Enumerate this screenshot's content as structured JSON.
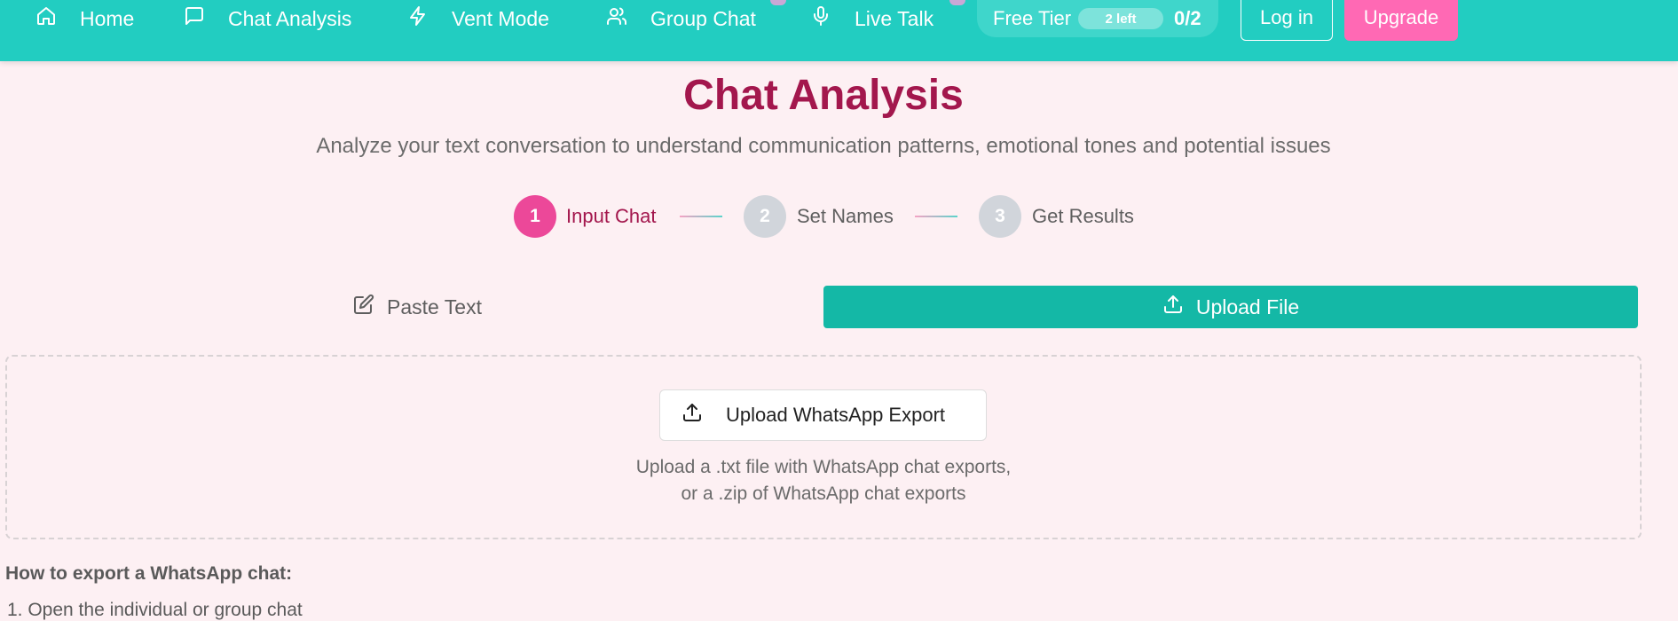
{
  "nav": {
    "items": [
      {
        "label": "Home",
        "icon": "home-icon"
      },
      {
        "label": "Chat Analysis",
        "icon": "message-square-icon"
      },
      {
        "label": "Vent Mode",
        "icon": "zap-icon"
      },
      {
        "label": "Group Chat",
        "icon": "users-icon"
      },
      {
        "label": "Live Talk",
        "icon": "mic-icon"
      }
    ],
    "free_tier": {
      "label": "Free Tier",
      "left": "2 left",
      "count": "0/2"
    },
    "login_label": "Log in",
    "upgrade_label": "Upgrade"
  },
  "header": {
    "title": "Chat Analysis",
    "subtitle": "Analyze your text conversation to understand communication patterns, emotional tones and potential issues"
  },
  "stepper": {
    "steps": [
      {
        "number": "1",
        "label": "Input Chat",
        "active": true
      },
      {
        "number": "2",
        "label": "Set Names",
        "active": false
      },
      {
        "number": "3",
        "label": "Get Results",
        "active": false
      }
    ]
  },
  "tabs": {
    "paste_label": "Paste Text",
    "upload_label": "Upload File",
    "selected": "upload"
  },
  "upload": {
    "button_label": "Upload WhatsApp Export",
    "help_line1": "Upload a .txt file with WhatsApp chat exports,",
    "help_line2": "or a .zip of WhatsApp chat exports"
  },
  "instructions": {
    "title": "How to export a WhatsApp chat:",
    "steps": [
      "1. Open the individual or group chat"
    ]
  },
  "colors": {
    "nav_bg": "#22cdc1",
    "accent_pink": "#ec4899",
    "title_color": "#a3174d",
    "tab_active": "#14b8a6",
    "upgrade": "#ff69b4",
    "page_bg": "#fdf0f3"
  }
}
